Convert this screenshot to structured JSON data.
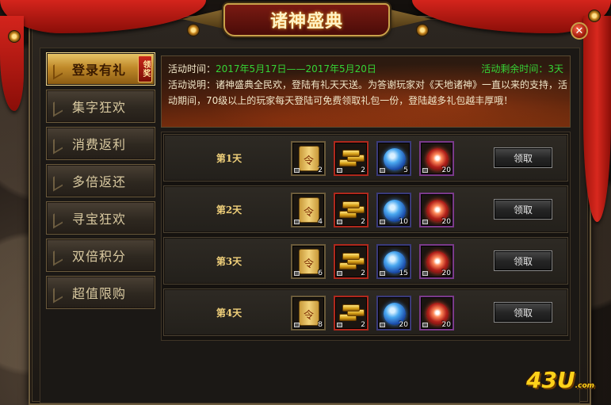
{
  "window": {
    "title": "诸神盛典",
    "close_icon": "close-icon"
  },
  "sidebar": {
    "items": [
      {
        "label": "登录有礼",
        "active": true,
        "badge": "领奖"
      },
      {
        "label": "集字狂欢",
        "active": false
      },
      {
        "label": "消费返利",
        "active": false
      },
      {
        "label": "多倍返还",
        "active": false
      },
      {
        "label": "寻宝狂欢",
        "active": false
      },
      {
        "label": "双倍积分",
        "active": false
      },
      {
        "label": "超值限购",
        "active": false
      }
    ]
  },
  "info": {
    "time_label": "活动时间：",
    "time_range": "2017年5月17日——2017年5月20日",
    "remaining": "活动剩余时间：3天",
    "desc_line1": "活动说明：诸神盛典全民欢，登陆有礼天天送。为答谢玩家对《天地诸神》一直以来的支持，活",
    "desc_line2": "动期间，70级以上的玩家每天登陆可免费领取礼包一份，登陆越多礼包越丰厚哦！"
  },
  "rewards": [
    {
      "day": "第1天",
      "items": [
        "2",
        "2",
        "5",
        "20"
      ],
      "button": "领取"
    },
    {
      "day": "第2天",
      "items": [
        "4",
        "2",
        "10",
        "20"
      ],
      "button": "领取"
    },
    {
      "day": "第3天",
      "items": [
        "6",
        "2",
        "15",
        "20"
      ],
      "button": "领取"
    },
    {
      "day": "第4天",
      "items": [
        "8",
        "2",
        "20",
        "20"
      ],
      "button": "领取"
    }
  ],
  "reward_item_icons": [
    "scroll-icon",
    "gold-bars-icon",
    "blue-orb-icon",
    "red-orb-icon"
  ],
  "watermark": {
    "text": "43U",
    "suffix": ".com"
  },
  "colors": {
    "accent_gold": "#e8c66a",
    "drape_red": "#d4241c",
    "highlight_green": "#36d436"
  }
}
